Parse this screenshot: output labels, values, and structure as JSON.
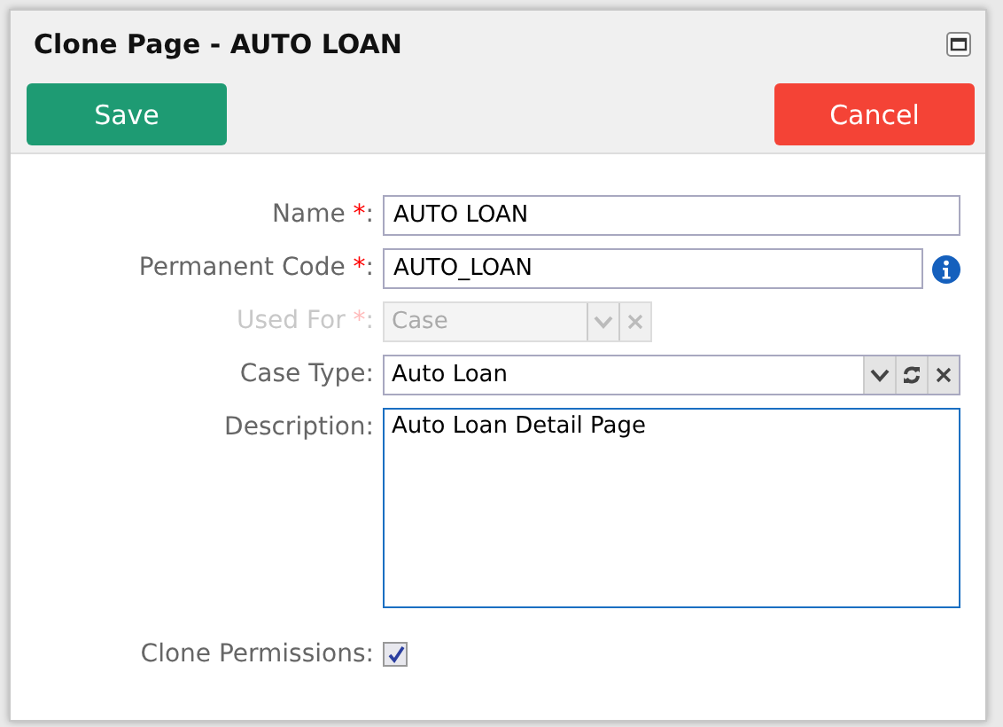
{
  "dialog": {
    "title": "Clone Page - AUTO LOAN"
  },
  "buttons": [
    {
      "label": "Save",
      "kind": "primary"
    },
    {
      "label": "Cancel",
      "kind": "danger"
    }
  ],
  "fields": [
    {
      "label": "Name",
      "required_mark": "*",
      "suffix": ":",
      "kind": "text",
      "value": "AUTO LOAN",
      "disabled": false
    },
    {
      "label": "Permanent Code",
      "required_mark": "*",
      "suffix": ":",
      "kind": "text-info",
      "value": "AUTO_LOAN",
      "disabled": false
    },
    {
      "label": "Used For",
      "required_mark": "*",
      "suffix": ":",
      "kind": "select",
      "value": "Case",
      "disabled": true
    },
    {
      "label": "Case Type",
      "suffix": ":",
      "kind": "select-refresh",
      "value": "Auto Loan",
      "disabled": false
    },
    {
      "label": "Description",
      "suffix": ":",
      "kind": "textarea",
      "value": "Auto Loan Detail Page",
      "disabled": false
    },
    {
      "label": "Clone Permissions",
      "suffix": ":",
      "kind": "checkbox",
      "checked": true,
      "disabled": false
    }
  ]
}
